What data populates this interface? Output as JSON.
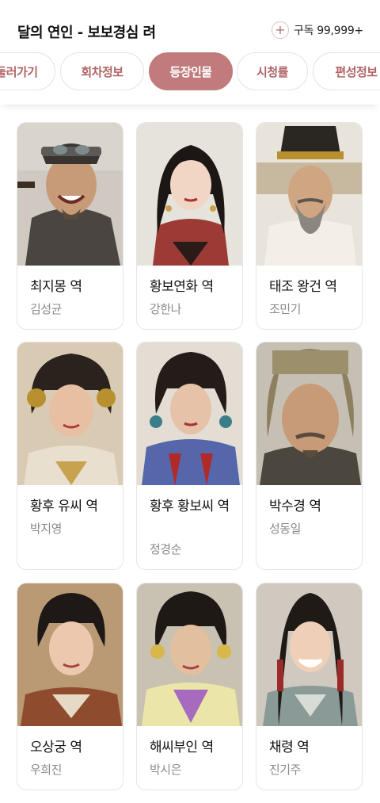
{
  "header": {
    "title": "달의 연인 - 보보경심 려",
    "subscribe_label": "구독 99,999+"
  },
  "tabs": [
    {
      "label": "둘러가기"
    },
    {
      "label": "회차정보"
    },
    {
      "label": "등장인물"
    },
    {
      "label": "시청률"
    },
    {
      "label": "편성정보"
    }
  ],
  "cast": [
    {
      "role": "최지몽 역",
      "actor": "김성균"
    },
    {
      "role": "황보연화 역",
      "actor": "강한나"
    },
    {
      "role": "태조 왕건 역",
      "actor": "조민기"
    },
    {
      "role": "황후 유씨 역",
      "actor": "박지영"
    },
    {
      "role": "황후 황보씨 역",
      "actor": "정경순"
    },
    {
      "role": "박수경 역",
      "actor": "성동일"
    },
    {
      "role": "오상궁 역",
      "actor": "우희진"
    },
    {
      "role": "해씨부인 역",
      "actor": "박시은"
    },
    {
      "role": "채령 역",
      "actor": "진기주"
    }
  ],
  "colors": {
    "accent": "#c17b7c",
    "accent_text": "#b06466"
  }
}
